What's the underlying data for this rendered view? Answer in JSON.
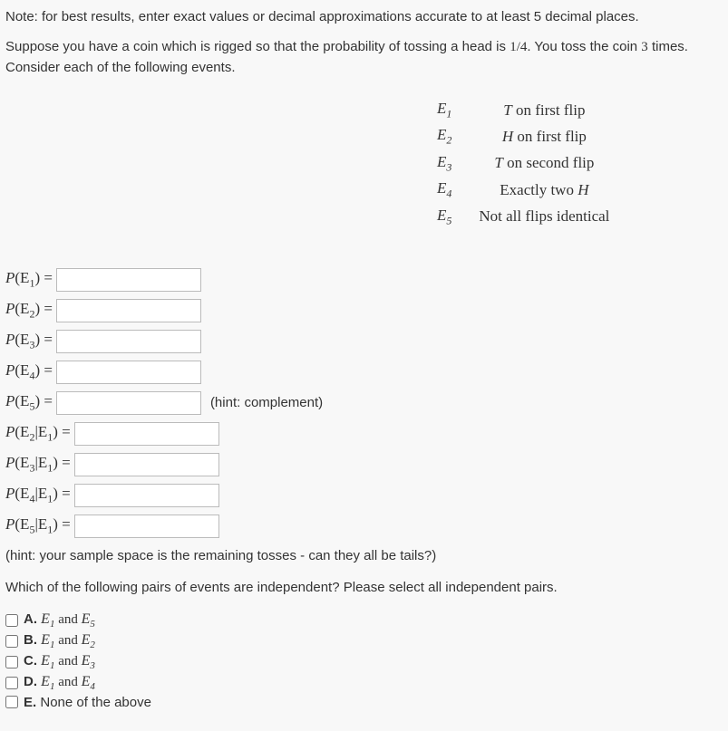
{
  "note": "Note: for best results, enter exact values or decimal approximations accurate to at least 5 decimal places.",
  "problem": {
    "p1": "Suppose you have a coin which is rigged so that the probability of tossing a head is ",
    "frac": "1/4",
    "p2": ". You toss the coin ",
    "tosses": "3",
    "p3": " times. Consider each of the following events."
  },
  "events": [
    {
      "label": "E",
      "sub": "1",
      "desc_pre": "T",
      "desc": " on first flip"
    },
    {
      "label": "E",
      "sub": "2",
      "desc_pre": "H",
      "desc": " on first flip"
    },
    {
      "label": "E",
      "sub": "3",
      "desc_pre": "T",
      "desc": " on second flip"
    },
    {
      "label": "E",
      "sub": "4",
      "desc_pre": "",
      "desc": "Exactly two ",
      "desc_post": "H"
    },
    {
      "label": "E",
      "sub": "5",
      "desc_pre": "",
      "desc": "Not all flips identical"
    }
  ],
  "inputs": [
    {
      "p": "P",
      "open": "(E",
      "sub": "1",
      "close": ") =",
      "value": "",
      "hint": ""
    },
    {
      "p": "P",
      "open": "(E",
      "sub": "2",
      "close": ") =",
      "value": "",
      "hint": ""
    },
    {
      "p": "P",
      "open": "(E",
      "sub": "3",
      "close": ") =",
      "value": "",
      "hint": ""
    },
    {
      "p": "P",
      "open": "(E",
      "sub": "4",
      "close": ") =",
      "value": "",
      "hint": ""
    },
    {
      "p": "P",
      "open": "(E",
      "sub": "5",
      "close": ") =",
      "value": "",
      "hint": "(hint: complement)"
    }
  ],
  "cond_inputs": [
    {
      "p": "P",
      "open": "(E",
      "sub1": "2",
      "mid": "|E",
      "sub2": "1",
      "close": ") =",
      "value": ""
    },
    {
      "p": "P",
      "open": "(E",
      "sub1": "3",
      "mid": "|E",
      "sub2": "1",
      "close": ") =",
      "value": ""
    },
    {
      "p": "P",
      "open": "(E",
      "sub1": "4",
      "mid": "|E",
      "sub2": "1",
      "close": ") =",
      "value": ""
    },
    {
      "p": "P",
      "open": "(E",
      "sub1": "5",
      "mid": "|E",
      "sub2": "1",
      "close": ") =",
      "value": ""
    }
  ],
  "hint2": "(hint: your sample space is the remaining tosses - can they all be tails?)",
  "question2": "Which of the following pairs of events are independent? Please select all independent pairs.",
  "choices": [
    {
      "letter": "A.",
      "e1": "E",
      "s1": "1",
      "and": " and ",
      "e2": "E",
      "s2": "5"
    },
    {
      "letter": "B.",
      "e1": "E",
      "s1": "1",
      "and": " and ",
      "e2": "E",
      "s2": "2"
    },
    {
      "letter": "C.",
      "e1": "E",
      "s1": "1",
      "and": " and ",
      "e2": "E",
      "s2": "3"
    },
    {
      "letter": "D.",
      "e1": "E",
      "s1": "1",
      "and": " and ",
      "e2": "E",
      "s2": "4"
    }
  ],
  "choice_e": {
    "letter": "E.",
    "text": " None of the above"
  }
}
